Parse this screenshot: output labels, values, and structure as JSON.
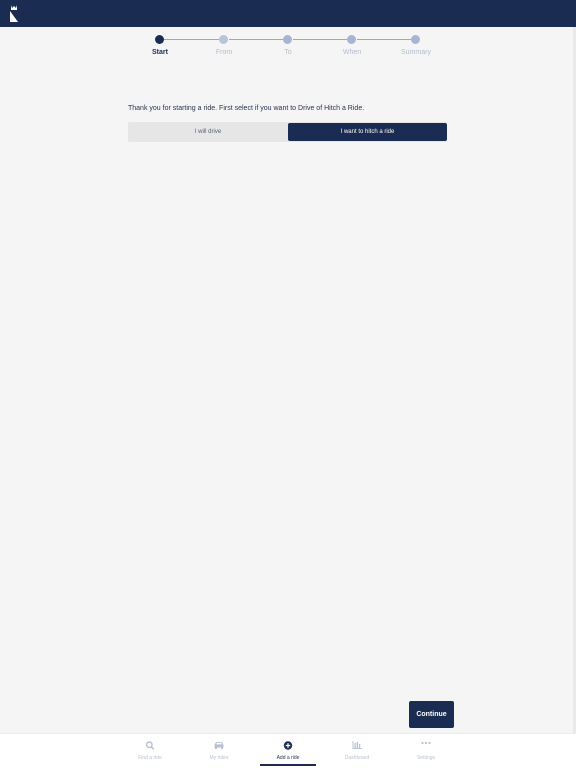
{
  "stepper": {
    "steps": [
      "Start",
      "From",
      "To",
      "When",
      "Summary"
    ],
    "active_index": 0
  },
  "intro_text": "Thank you for starting a ride. First select if you want to Drive of Hitch a Ride.",
  "mode_toggle": {
    "options": [
      "I will drive",
      "I want to hitch a ride"
    ],
    "selected": "I want to hitch a ride"
  },
  "continue_label": "Continue",
  "bottom_nav": {
    "items": [
      {
        "label": "Find a ride",
        "icon": "search-icon"
      },
      {
        "label": "My rides",
        "icon": "car-icon"
      },
      {
        "label": "Add a ride",
        "icon": "plus-circle-icon"
      },
      {
        "label": "Dashboard",
        "icon": "bar-chart-icon"
      },
      {
        "label": "Settings",
        "icon": "more-icon"
      }
    ],
    "active": "Add a ride"
  },
  "colors": {
    "primary": "#1b2c52",
    "background": "#f5f5f5",
    "inactive": "#b8c0d2"
  }
}
